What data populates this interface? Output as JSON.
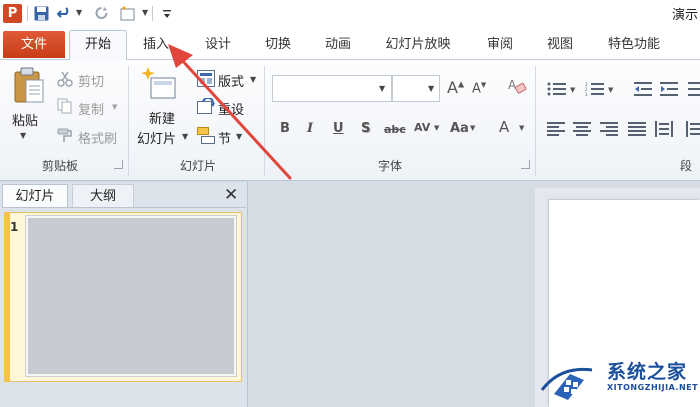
{
  "window": {
    "app_icon_letter": "P",
    "title_partial": "演示"
  },
  "ribbon_tabs": {
    "file": "文件",
    "home": "开始",
    "insert": "插入",
    "design": "设计",
    "transitions": "切换",
    "animations": "动画",
    "slideshow": "幻灯片放映",
    "review": "审阅",
    "view": "视图",
    "special": "特色功能"
  },
  "clipboard": {
    "paste": "粘贴",
    "cut": "剪切",
    "copy": "复制",
    "format_painter": "格式刷",
    "group_label": "剪贴板"
  },
  "slides_group": {
    "new_slide_line1": "新建",
    "new_slide_line2": "幻灯片",
    "layout": "版式",
    "reset": "重设",
    "section": "节",
    "group_label": "幻灯片"
  },
  "font_group": {
    "font_name": "",
    "font_size": "",
    "grow": "A",
    "shrink": "A",
    "bold": "B",
    "italic": "I",
    "underline": "U",
    "shadow": "S",
    "strike": "abc",
    "spacing": "AV",
    "case": "Aa",
    "color": "A",
    "group_label": "字体"
  },
  "paragraph_group": {
    "group_label_partial": "段"
  },
  "left_pane": {
    "tab_slides": "幻灯片",
    "tab_outline": "大纲",
    "close": "✕",
    "slide_number": "1"
  },
  "watermark": {
    "title": "系统之家",
    "subtitle": "XITONGZHIJIA.NET"
  },
  "colors": {
    "file_tab": "#d04423",
    "annotation_arrow": "#e0463c",
    "watermark": "#1b4f9c"
  }
}
